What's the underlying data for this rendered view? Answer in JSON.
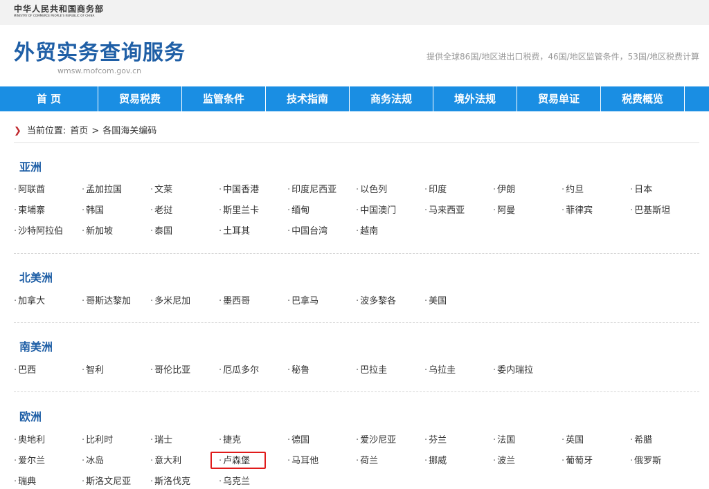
{
  "header": {
    "ministry_cn": "中华人民共和国商务部",
    "ministry_en": "MINISTRY OF COMMERCE PEOPLE'S REPUBLIC OF CHINA",
    "site_title": "外贸实务查询服务",
    "site_domain": "wmsw.mofcom.gov.cn",
    "description": "提供全球86国/地区进出口税费，46国/地区监管条件，53国/地区税费计算"
  },
  "nav": [
    "首 页",
    "贸易税费",
    "监管条件",
    "技术指南",
    "商务法规",
    "境外法规",
    "贸易单证",
    "税费概览"
  ],
  "breadcrumb": {
    "prefix": "当前位置:",
    "home": "首页",
    "separator": ">",
    "current": "各国海关编码"
  },
  "regions": [
    {
      "name": "亚洲",
      "countries": [
        "阿联酋",
        "孟加拉国",
        "文莱",
        "中国香港",
        "印度尼西亚",
        "以色列",
        "印度",
        "伊朗",
        "约旦",
        "日本",
        "柬埔寨",
        "韩国",
        "老挝",
        "斯里兰卡",
        "缅甸",
        "中国澳门",
        "马来西亚",
        "阿曼",
        "菲律宾",
        "巴基斯坦",
        "沙特阿拉伯",
        "新加坡",
        "泰国",
        "土耳其",
        "中国台湾",
        "越南"
      ]
    },
    {
      "name": "北美洲",
      "countries": [
        "加拿大",
        "哥斯达黎加",
        "多米尼加",
        "墨西哥",
        "巴拿马",
        "波多黎各",
        "美国"
      ]
    },
    {
      "name": "南美洲",
      "countries": [
        "巴西",
        "智利",
        "哥伦比亚",
        "厄瓜多尔",
        "秘鲁",
        "巴拉圭",
        "乌拉圭",
        "委内瑞拉"
      ]
    },
    {
      "name": "欧洲",
      "countries": [
        "奥地利",
        "比利时",
        "瑞士",
        "捷克",
        "德国",
        "爱沙尼亚",
        "芬兰",
        "法国",
        "英国",
        "希腊",
        "爱尔兰",
        "冰岛",
        "意大利",
        "卢森堡",
        "马耳他",
        "荷兰",
        "挪威",
        "波兰",
        "葡萄牙",
        "俄罗斯",
        "瑞典",
        "斯洛文尼亚",
        "斯洛伐克",
        "乌克兰"
      ]
    }
  ],
  "highlighted_country": "卢森堡",
  "colors": {
    "nav_bg": "#1a8ee3",
    "title_blue": "#1f5fa6",
    "highlight_border": "#e01b1b",
    "breadcrumb_arrow": "#c0282d"
  }
}
